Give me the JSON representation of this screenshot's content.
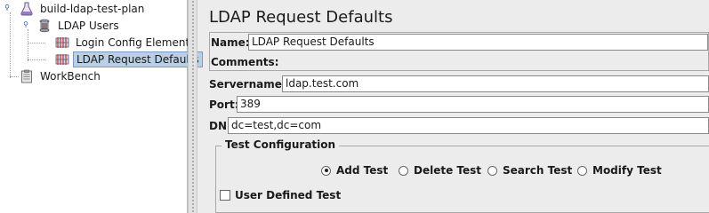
{
  "tree": {
    "items": [
      {
        "label": "build-ldap-test-plan",
        "icon": "test-plan-flask-icon"
      },
      {
        "label": "LDAP Users",
        "icon": "thread-group-spool-icon"
      },
      {
        "label": "Login Config Element",
        "icon": "config-element-icon"
      },
      {
        "label": "LDAP Request Defaults",
        "icon": "config-element-icon",
        "selected": true
      },
      {
        "label": "WorkBench",
        "icon": "workbench-clipboard-icon"
      }
    ]
  },
  "panel": {
    "title": "LDAP Request Defaults",
    "name_label": "Name:",
    "name_value": "LDAP Request Defaults",
    "comments_label": "Comments:",
    "servername_label": "Servername :",
    "servername_value": "ldap.test.com",
    "port_label": "Port:",
    "port_value": "389",
    "dn_label": "DN",
    "dn_value": "dc=test,dc=com",
    "test_config": {
      "title": "Test Configuration",
      "options": [
        "Add Test",
        "Delete Test",
        "Search Test",
        "Modify Test"
      ],
      "selected": "Add Test",
      "user_defined_label": "User Defined Test",
      "user_defined_checked": false
    }
  },
  "colors": {
    "selection_bg": "#b8cfe5",
    "panel_bg": "#ececec",
    "tree_bg": "#ffffff"
  }
}
